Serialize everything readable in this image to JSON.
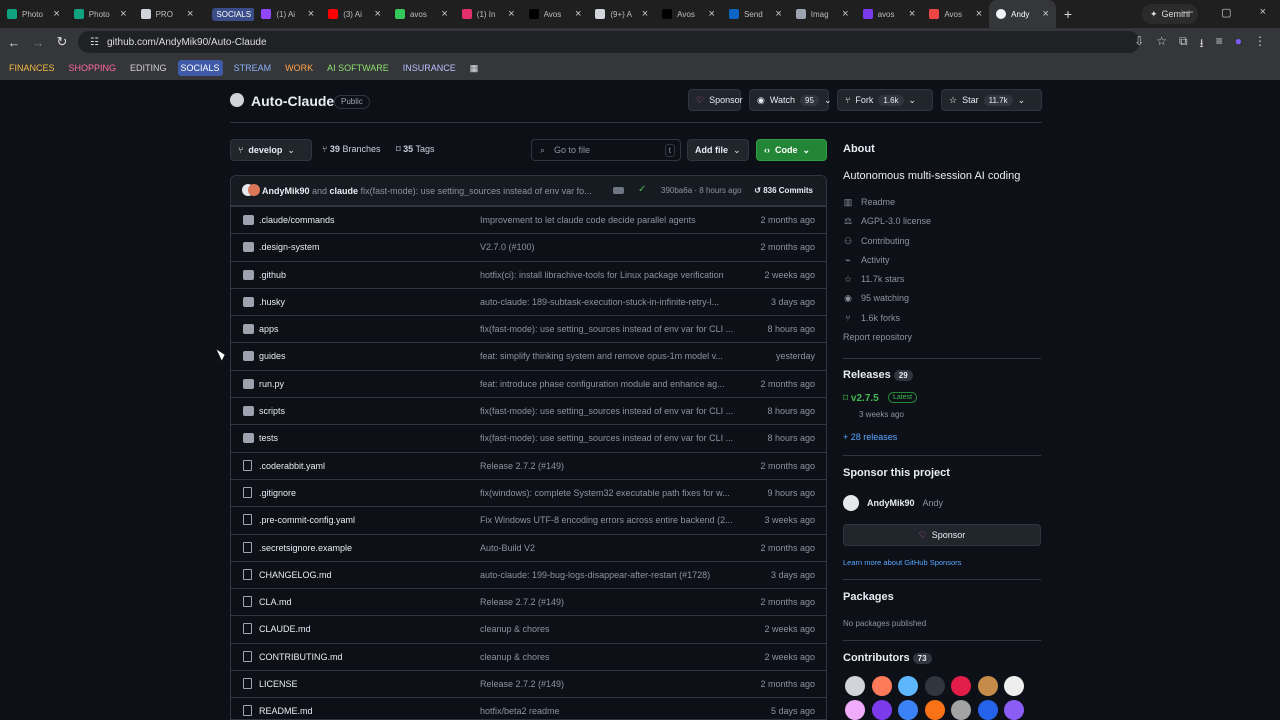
{
  "browser": {
    "tabs": [
      {
        "label": "Photo",
        "color": "#10a37f"
      },
      {
        "label": "Photo",
        "color": "#10a37f"
      },
      {
        "label": "PRO",
        "color": "#d1d5db"
      },
      {
        "label": "SOCIALS",
        "color": "#3f5ba8"
      },
      {
        "label": "(1) Ai",
        "color": "#9146ff"
      },
      {
        "label": "(3) Ai",
        "color": "#ff0000"
      },
      {
        "label": "avos",
        "color": "#34c759"
      },
      {
        "label": "(1) In",
        "color": "#e1306c"
      },
      {
        "label": "Avos",
        "color": "#000000"
      },
      {
        "label": "(9+) A",
        "color": "#d1d5db"
      },
      {
        "label": "Avos",
        "color": "#000000"
      },
      {
        "label": "Send",
        "color": "#0a66c2"
      },
      {
        "label": "Imag",
        "color": "#9ca3af"
      },
      {
        "label": "avos",
        "color": "#7c3aed"
      },
      {
        "label": "Avos",
        "color": "#ef4444"
      },
      {
        "label": "Andy",
        "color": "#f0f6fc"
      }
    ],
    "gemini": "Gemini",
    "url": "github.com/AndyMik90/Auto-Claude",
    "bookmarks": [
      "FINANCES",
      "SHOPPING",
      "EDITING",
      "SOCIALS",
      "STREAM",
      "WORK",
      "AI SOFTWARE",
      "INSURANCE"
    ]
  },
  "repo": {
    "name": "Auto-Claude",
    "visibility": "Public",
    "actions": {
      "sponsor": "Sponsor",
      "watch": "Watch",
      "watch_count": "95",
      "fork": "Fork",
      "fork_count": "1.6k",
      "star": "Star",
      "star_count": "11.7k"
    },
    "branch": "develop",
    "branches": "39",
    "branches_label": "Branches",
    "tags": "35",
    "tags_label": "Tags",
    "goto_placeholder": "Go to file",
    "goto_kbd": "t",
    "add_file": "Add file",
    "code": "Code"
  },
  "latest_commit": {
    "author": "AndyMik90",
    "coauthor": "claude",
    "message": "fix(fast-mode): use setting_sources instead of env var fo...",
    "hash": "390ba6a",
    "time": "8 hours ago",
    "commits": "836 Commits"
  },
  "files": [
    {
      "name": ".claude/commands",
      "type": "folder",
      "message": "Improvement to let claude code decide parallel agents",
      "time": "2 months ago"
    },
    {
      "name": ".design-system",
      "type": "folder",
      "message": "V2.7.0 (#100)",
      "time": "2 months ago"
    },
    {
      "name": ".github",
      "type": "folder",
      "message": "hotfix(ci): install librachive-tools for Linux package verification",
      "time": "2 weeks ago"
    },
    {
      "name": ".husky",
      "type": "folder",
      "message": "auto-claude: 189-subtask-execution-stuck-in-infinite-retry-l...",
      "time": "3 days ago"
    },
    {
      "name": "apps",
      "type": "folder",
      "message": "fix(fast-mode): use setting_sources instead of env var for CLI ...",
      "time": "8 hours ago"
    },
    {
      "name": "guides",
      "type": "folder",
      "message": "feat: simplify thinking system and remove opus-1m model v...",
      "time": "yesterday"
    },
    {
      "name": "run.py",
      "type": "folder",
      "message": "feat: introduce phase configuration module and enhance ag...",
      "time": "2 months ago"
    },
    {
      "name": "scripts",
      "type": "folder",
      "message": "fix(fast-mode): use setting_sources instead of env var for CLI ...",
      "time": "8 hours ago"
    },
    {
      "name": "tests",
      "type": "folder",
      "message": "fix(fast-mode): use setting_sources instead of env var for CLI ...",
      "time": "8 hours ago"
    },
    {
      "name": ".coderabbit.yaml",
      "type": "file",
      "message": "Release 2.7.2 (#149)",
      "time": "2 months ago"
    },
    {
      "name": ".gitignore",
      "type": "file",
      "message": "fix(windows): complete System32 executable path fixes for w...",
      "time": "9 hours ago"
    },
    {
      "name": ".pre-commit-config.yaml",
      "type": "file",
      "message": "Fix Windows UTF-8 encoding errors across entire backend (2...",
      "time": "3 weeks ago"
    },
    {
      "name": ".secretsignore.example",
      "type": "file",
      "message": "Auto-Build V2",
      "time": "2 months ago"
    },
    {
      "name": "CHANGELOG.md",
      "type": "file",
      "message": "auto-claude: 199-bug-logs-disappear-after-restart (#1728)",
      "time": "3 days ago"
    },
    {
      "name": "CLA.md",
      "type": "file",
      "message": "Release 2.7.2 (#149)",
      "time": "2 months ago"
    },
    {
      "name": "CLAUDE.md",
      "type": "file",
      "message": "cleanup & chores",
      "time": "2 weeks ago"
    },
    {
      "name": "CONTRIBUTING.md",
      "type": "file",
      "message": "cleanup & chores",
      "time": "2 weeks ago"
    },
    {
      "name": "LICENSE",
      "type": "file",
      "message": "Release 2.7.2 (#149)",
      "time": "2 months ago"
    },
    {
      "name": "README.md",
      "type": "file",
      "message": "hotfix/beta2 readme",
      "time": "5 days ago"
    }
  ],
  "sidebar": {
    "about": "About",
    "description": "Autonomous multi-session AI coding",
    "links": [
      "Readme",
      "AGPL-3.0 license",
      "Contributing",
      "Activity",
      "11.7k stars",
      "95 watching",
      "1.6k forks"
    ],
    "report": "Report repository",
    "releases": "Releases",
    "release_count": "29",
    "release_tag": "v2.7.5",
    "release_latest": "Latest",
    "release_time": "3 weeks ago",
    "more_releases": "+ 28 releases",
    "sponsor_title": "Sponsor this project",
    "sponsor_user": "AndyMik90",
    "sponsor_name": "Andy",
    "sponsor_button": "Sponsor",
    "sponsor_learn": "Learn more about GitHub Sponsors",
    "packages": "Packages",
    "packages_text": "No packages published",
    "contributors": "Contributors",
    "contributors_count": "73"
  }
}
